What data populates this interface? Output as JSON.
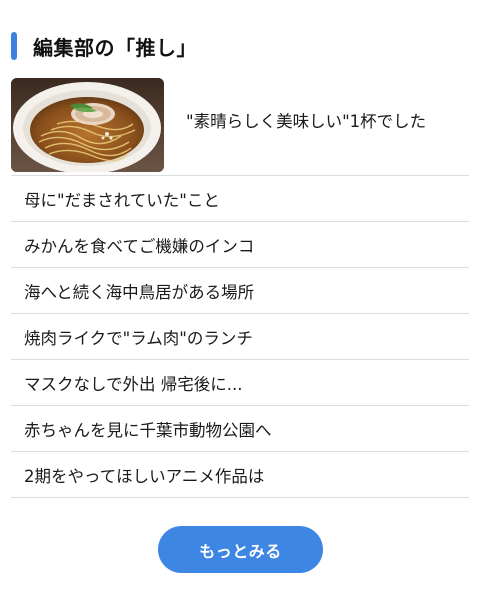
{
  "section": {
    "title": "編集部の「推し」",
    "accent_color": "#3b82e0"
  },
  "featured": {
    "image_icon": "ramen-photo",
    "text": "\"素晴らしく美味しい\"1杯でした"
  },
  "list": {
    "items": [
      "母に\"だまされていた\"こと",
      "みかんを食べてご機嫌のインコ",
      "海へと続く海中鳥居がある場所",
      "焼肉ライクで\"ラム肉\"のランチ",
      "マスクなしで外出 帰宅後に...",
      "赤ちゃんを見に千葉市動物公園へ",
      "2期をやってほしいアニメ作品は"
    ]
  },
  "more_button": {
    "label": "もっとみる",
    "color": "#3d86e4"
  }
}
